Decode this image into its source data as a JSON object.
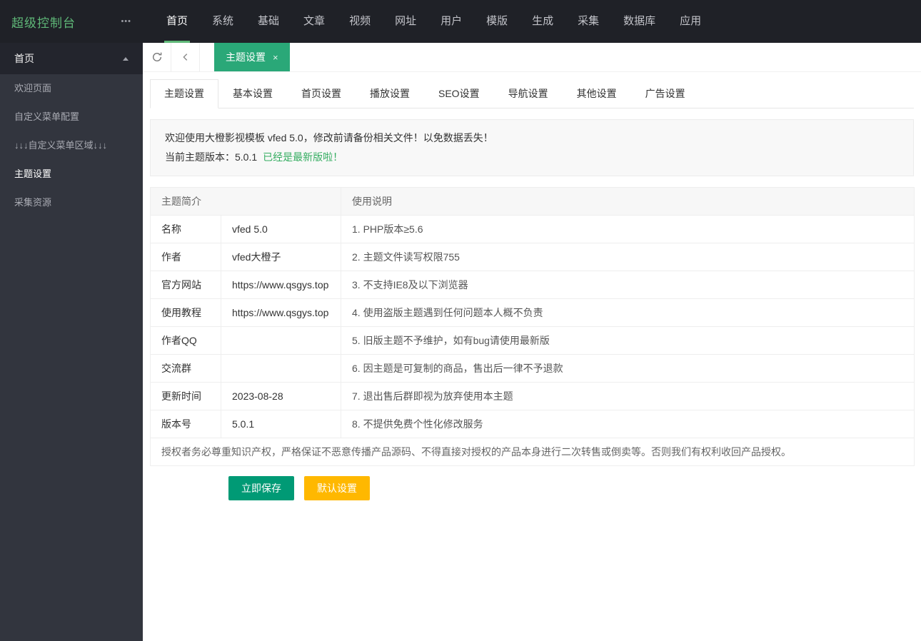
{
  "topbar": {
    "brand": "超级控制台",
    "more": "•••",
    "nav": [
      {
        "label": "首页",
        "active": true
      },
      {
        "label": "系统",
        "active": false
      },
      {
        "label": "基础",
        "active": false
      },
      {
        "label": "文章",
        "active": false
      },
      {
        "label": "视频",
        "active": false
      },
      {
        "label": "网址",
        "active": false
      },
      {
        "label": "用户",
        "active": false
      },
      {
        "label": "模版",
        "active": false
      },
      {
        "label": "生成",
        "active": false
      },
      {
        "label": "采集",
        "active": false
      },
      {
        "label": "数据库",
        "active": false
      },
      {
        "label": "应用",
        "active": false
      }
    ]
  },
  "sidebar": {
    "section_label": "首页",
    "items": [
      {
        "label": "欢迎页面",
        "active": false
      },
      {
        "label": "自定义菜单配置",
        "active": false
      },
      {
        "label": "↓↓↓自定义菜单区域↓↓↓",
        "active": false
      },
      {
        "label": "主题设置",
        "active": true
      },
      {
        "label": "采集资源",
        "active": false
      }
    ]
  },
  "tabbar": {
    "active_tab_label": "主题设置",
    "close_label": "×"
  },
  "subtabs": [
    {
      "label": "主题设置",
      "active": true
    },
    {
      "label": "基本设置",
      "active": false
    },
    {
      "label": "首页设置",
      "active": false
    },
    {
      "label": "播放设置",
      "active": false
    },
    {
      "label": "SEO设置",
      "active": false
    },
    {
      "label": "导航设置",
      "active": false
    },
    {
      "label": "其他设置",
      "active": false
    },
    {
      "label": "广告设置",
      "active": false
    }
  ],
  "notice": {
    "line1": "欢迎使用大橙影视模板 vfed 5.0，修改前请备份相关文件！以免数据丢失！",
    "version_label": "当前主题版本：",
    "version": "5.0.1",
    "status": "已经是最新版啦！"
  },
  "table": {
    "header_left": "主题简介",
    "header_right": "使用说明",
    "rows": [
      {
        "label": "名称",
        "value": "vfed 5.0",
        "note": "1. PHP版本≥5.6"
      },
      {
        "label": "作者",
        "value": "vfed大橙子",
        "note": "2. 主题文件读写权限755"
      },
      {
        "label": "官方网站",
        "value": "https://www.qsgys.top",
        "note": "3. 不支持IE8及以下浏览器"
      },
      {
        "label": "使用教程",
        "value": "https://www.qsgys.top",
        "note": "4. 使用盗版主题遇到任何问题本人概不负责"
      },
      {
        "label": "作者QQ",
        "value": "",
        "note": "5. 旧版主题不予维护，如有bug请使用最新版"
      },
      {
        "label": "交流群",
        "value": "",
        "note": "6. 因主题是可复制的商品，售出后一律不予退款"
      },
      {
        "label": "更新时间",
        "value": "2023-08-28",
        "note": "7. 退出售后群即视为放弃使用本主题"
      },
      {
        "label": "版本号",
        "value": "5.0.1",
        "note": "8. 不提供免费个性化修改服务"
      }
    ],
    "footer": "授权者务必尊重知识产权，严格保证不恶意传播产品源码、不得直接对授权的产品本身进行二次转售或倒卖等。否则我们有权利收回产品授权。"
  },
  "buttons": {
    "save": "立即保存",
    "default": "默认设置"
  },
  "colors": {
    "brand_green": "#5fb878",
    "tab_green": "#2aa878",
    "save_green": "#009a75",
    "warning_orange": "#ffb800",
    "status_green": "#35ad61",
    "topbar_bg": "#1f2127",
    "sidebar_bg": "#32353e"
  }
}
